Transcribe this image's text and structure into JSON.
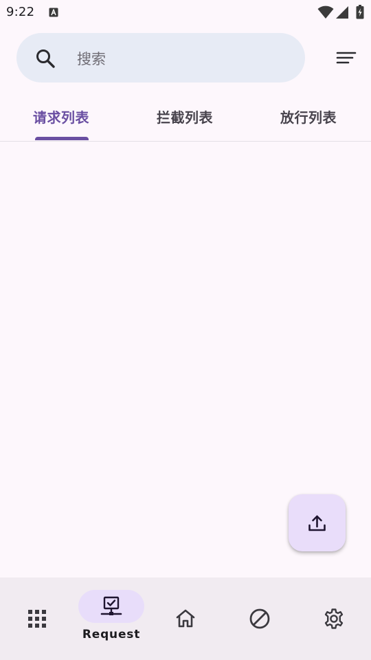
{
  "status_bar": {
    "time": "9:22",
    "icons": [
      "notification-a-icon",
      "wifi-icon",
      "signal-icon",
      "battery-icon"
    ]
  },
  "search": {
    "placeholder": "搜索",
    "icon": "search-icon",
    "filter_icon": "sort-icon"
  },
  "tabs": [
    {
      "label": "请求列表",
      "active": true
    },
    {
      "label": "拦截列表",
      "active": false
    },
    {
      "label": "放行列表",
      "active": false
    }
  ],
  "list": {
    "items": []
  },
  "fab": {
    "icon": "upload-icon"
  },
  "bottom_nav": {
    "items": [
      {
        "icon": "apps-grid-icon",
        "label": "",
        "active": false
      },
      {
        "icon": "request-monitor-icon",
        "label": "Request",
        "active": true
      },
      {
        "icon": "home-icon",
        "label": "",
        "active": false
      },
      {
        "icon": "block-icon",
        "label": "",
        "active": false
      },
      {
        "icon": "settings-icon",
        "label": "",
        "active": false
      }
    ]
  },
  "colors": {
    "background": "#FDF7FC",
    "accent": "#6A4FA2",
    "search_bg": "#E7EBF5",
    "fab_bg": "#E9DDFA",
    "nav_bg": "#F1EBF1",
    "nav_active_pill": "#E8DDFA"
  }
}
